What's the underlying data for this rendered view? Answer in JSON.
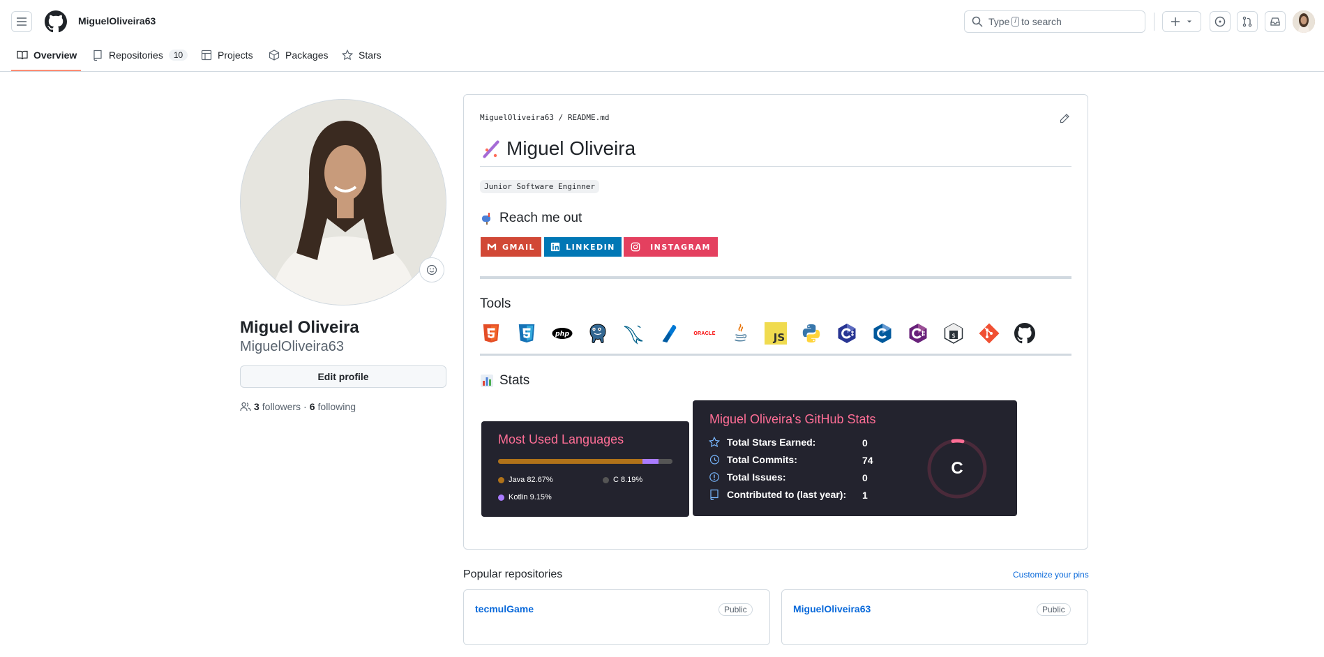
{
  "header": {
    "username": "MiguelOliveira63",
    "search_placeholder_pre": "Type",
    "search_key": "/",
    "search_placeholder_post": "to search"
  },
  "tabs": [
    {
      "label": "Overview"
    },
    {
      "label": "Repositories",
      "count": "10"
    },
    {
      "label": "Projects"
    },
    {
      "label": "Packages"
    },
    {
      "label": "Stars"
    }
  ],
  "profile": {
    "name": "Miguel Oliveira",
    "login": "MiguelOliveira63",
    "edit_label": "Edit profile",
    "followers_count": "3",
    "followers_label": "followers",
    "separator": "·",
    "following_count": "6",
    "following_label": "following"
  },
  "readme": {
    "path_user": "MiguelOliveira63",
    "path_sep": "/",
    "path_file": "README.md",
    "title": "Miguel Oliveira",
    "role": "Junior Software Enginner",
    "reach_heading": "Reach me out",
    "badges": [
      "GMAIL",
      "LINKEDIN",
      "INSTAGRAM"
    ],
    "tools_heading": "Tools",
    "tools": [
      "html5-icon",
      "css3-icon",
      "php-icon",
      "postgresql-icon",
      "mysql-icon",
      "azure-data-studio-icon",
      "oracle-icon",
      "java-icon",
      "javascript-icon",
      "python-icon",
      "c-icon",
      "c-plus-plus-icon",
      "c-sharp-icon",
      "bash-icon",
      "git-icon",
      "github-icon"
    ],
    "oracle_label": "ORACLE",
    "js_label": "JS",
    "php_label": "php",
    "stats_heading": "Stats"
  },
  "languages_card": {
    "title": "Most Used Languages",
    "langs": [
      {
        "name": "Java",
        "percent": "82.67%",
        "value": 82.67,
        "color": "#b07219"
      },
      {
        "name": "C",
        "percent": "8.19%",
        "value": 8.19,
        "color": "#555555"
      },
      {
        "name": "Kotlin",
        "percent": "9.15%",
        "value": 9.15,
        "color": "#A97BFF"
      }
    ]
  },
  "stats_card": {
    "title": "Miguel Oliveira's GitHub Stats",
    "rows": [
      {
        "label": "Total Stars Earned:",
        "value": "0"
      },
      {
        "label": "Total Commits:",
        "value": "74"
      },
      {
        "label": "Total Issues:",
        "value": "0"
      },
      {
        "label": "Contributed to (last year):",
        "value": "1"
      }
    ],
    "rank": "C"
  },
  "popular": {
    "heading": "Popular repositories",
    "customize": "Customize your pins",
    "repos": [
      {
        "name": "tecmulGame",
        "visibility": "Public"
      },
      {
        "name": "MiguelOliveira63",
        "visibility": "Public"
      }
    ]
  }
}
